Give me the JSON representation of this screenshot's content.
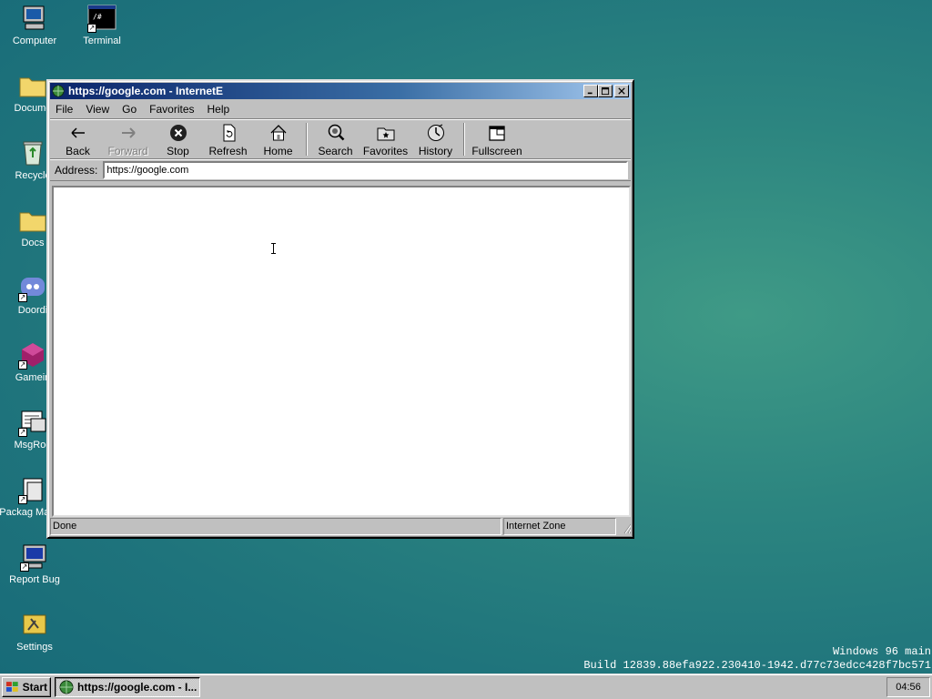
{
  "desktop": {
    "icons": [
      {
        "label": "Computer"
      },
      {
        "label": "Terminal"
      },
      {
        "label": "Docume"
      },
      {
        "label": "Recycle"
      },
      {
        "label": "Docs"
      },
      {
        "label": "Doordi"
      },
      {
        "label": "Gamein"
      },
      {
        "label": "MsgRoo"
      },
      {
        "label": "Packag Manag"
      },
      {
        "label": "Report Bug"
      },
      {
        "label": "Settings"
      }
    ]
  },
  "window": {
    "title": "https://google.com - InternetE",
    "menu": [
      "File",
      "View",
      "Go",
      "Favorites",
      "Help"
    ],
    "toolbar": {
      "back": "Back",
      "forward": "Forward",
      "stop": "Stop",
      "refresh": "Refresh",
      "home": "Home",
      "search": "Search",
      "favorites": "Favorites",
      "history": "History",
      "fullscreen": "Fullscreen"
    },
    "address": {
      "label": "Address:",
      "value": "https://google.com"
    },
    "status": {
      "text": "Done",
      "zone": "Internet Zone"
    }
  },
  "watermark": {
    "line1": "Windows 96 main",
    "line2": "Build 12839.88efa922.230410-1942.d77c73edcc428f7bc571"
  },
  "taskbar": {
    "start": "Start",
    "task": "https://google.com - I...",
    "clock": "04:56"
  },
  "colors": {
    "titlebar_start": "#0a246a",
    "desktop": "#2c8580",
    "chrome": "#c0c0c0"
  }
}
